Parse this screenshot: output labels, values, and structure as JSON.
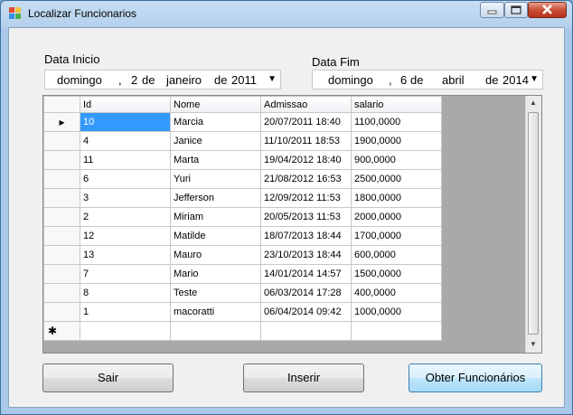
{
  "window": {
    "title": "Localizar Funcionarios"
  },
  "colors": {
    "selection": "#3399ff",
    "title_bar": "#b5d0ec",
    "close_button": "#c94f36"
  },
  "icons": {
    "app": "form-icon",
    "min": "minimize-icon",
    "max": "maximize-icon",
    "close": "close-icon"
  },
  "start": {
    "label": "Data Inicio",
    "weekday": "domingo",
    "sep": ",",
    "day": "2",
    "de1": "de",
    "month": "janeiro",
    "de2": "de",
    "year": "2011"
  },
  "end": {
    "label": "Data Fim",
    "weekday": "domingo",
    "sep": ",",
    "day": "6",
    "de1": "de",
    "month": "abril",
    "de2": "de",
    "year": "2014"
  },
  "grid": {
    "columns": [
      "Id",
      "Nome",
      "Admissao",
      "salario"
    ],
    "rows": [
      [
        "10",
        "Marcia",
        "20/07/2011 18:40",
        "1100,0000"
      ],
      [
        "4",
        "Janice",
        "11/10/2011 18:53",
        "1900,0000"
      ],
      [
        "11",
        "Marta",
        "19/04/2012 18:40",
        "900,0000"
      ],
      [
        "6",
        "Yuri",
        "21/08/2012 16:53",
        "2500,0000"
      ],
      [
        "3",
        "Jefferson",
        "12/09/2012 11:53",
        "1800,0000"
      ],
      [
        "2",
        "Miriam",
        "20/05/2013 11:53",
        "2000,0000"
      ],
      [
        "12",
        "Matilde",
        "18/07/2013 18:44",
        "1700,0000"
      ],
      [
        "13",
        "Mauro",
        "23/10/2013 18:44",
        "600,0000"
      ],
      [
        "7",
        "Mario",
        "14/01/2014 14:57",
        "1500,0000"
      ],
      [
        "8",
        "Teste",
        "06/03/2014 17:28",
        "400,0000"
      ],
      [
        "1",
        "macoratti",
        "06/04/2014 09:42",
        "1000,0000"
      ]
    ],
    "current_row_marker": "▸",
    "new_row_marker": "✱"
  },
  "buttons": {
    "sair": "Sair",
    "inserir": "Inserir",
    "obter": "Obter Funcionários"
  }
}
